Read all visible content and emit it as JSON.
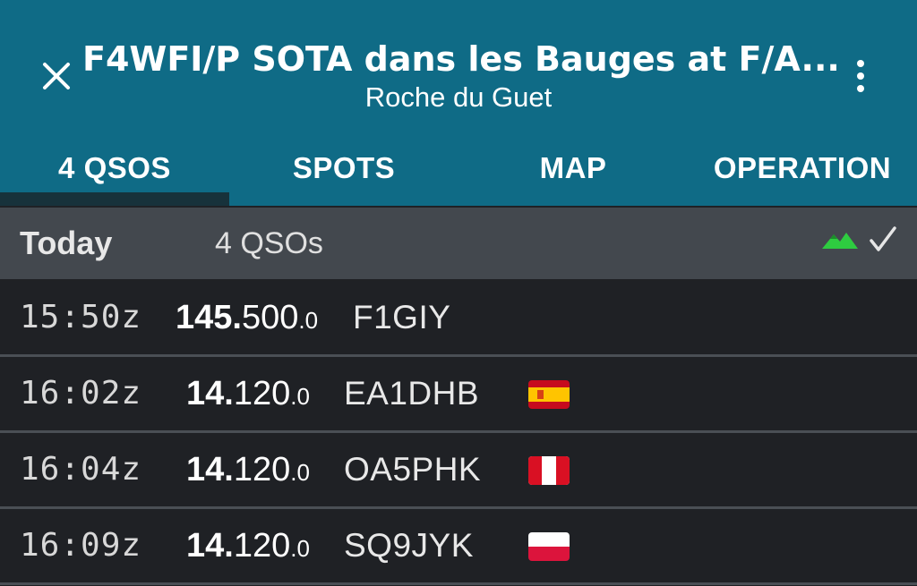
{
  "header": {
    "title": "F4WFI/P SOTA dans les Bauges at F/A...",
    "subtitle": "Roche du Guet"
  },
  "tabs": [
    {
      "label": "4 QSOS",
      "active": true
    },
    {
      "label": "SPOTS",
      "active": false
    },
    {
      "label": "MAP",
      "active": false
    },
    {
      "label": "OPERATION",
      "active": false
    }
  ],
  "day": {
    "label": "Today",
    "count": "4 QSOs",
    "icons": [
      "mountain-icon",
      "check-icon"
    ]
  },
  "qsos": [
    {
      "time": "15:50z",
      "freq_mhz": "145.",
      "freq_khz": "500",
      "freq_hz": ".0",
      "call": "F1GIY",
      "flag": ""
    },
    {
      "time": "16:02z",
      "freq_mhz": "14.",
      "freq_khz": "120",
      "freq_hz": ".0",
      "call": "EA1DHB",
      "flag": "spain-flag-icon"
    },
    {
      "time": "16:04z",
      "freq_mhz": "14.",
      "freq_khz": "120",
      "freq_hz": ".0",
      "call": "OA5PHK",
      "flag": "peru-flag-icon"
    },
    {
      "time": "16:09z",
      "freq_mhz": "14.",
      "freq_khz": "120",
      "freq_hz": ".0",
      "call": "SQ9JYK",
      "flag": "poland-flag-icon"
    }
  ],
  "colors": {
    "appbar": "#0f6b86",
    "tab_indicator": "#17323b",
    "day_header": "#43484e",
    "row_bg": "#1f2125",
    "mountain": "#2ecc40"
  }
}
